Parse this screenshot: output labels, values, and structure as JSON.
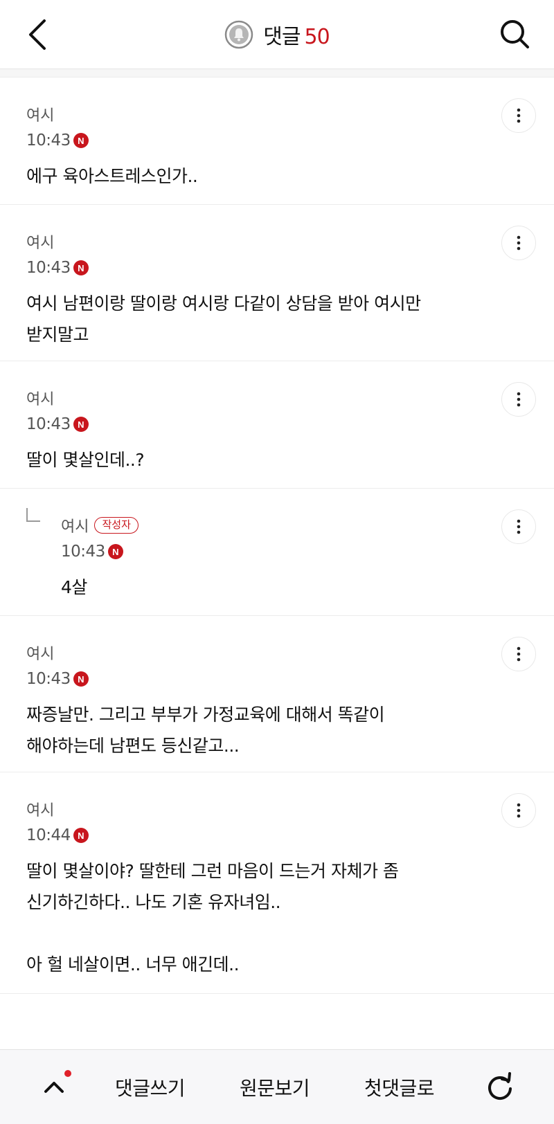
{
  "header": {
    "title": "댓글",
    "count": "50",
    "accent_color": "#c8161d"
  },
  "comments": [
    {
      "author": "여시",
      "time": "10:43",
      "new_badge": "N",
      "body": "에구 육아스트레스인가.."
    },
    {
      "author": "여시",
      "time": "10:43",
      "new_badge": "N",
      "body": "여시 남편이랑 딸이랑 여시랑 다같이 상담을 받아 여시만\n받지말고"
    },
    {
      "author": "여시",
      "time": "10:43",
      "new_badge": "N",
      "body": "딸이 몇살인데..?"
    },
    {
      "author": "여시",
      "author_badge": "작성자",
      "time": "10:43",
      "new_badge": "N",
      "body": "4살"
    },
    {
      "author": "여시",
      "time": "10:43",
      "new_badge": "N",
      "body": "짜증날만. 그리고 부부가 가정교육에 대해서 똑같이\n해야하는데 남편도 등신같고..."
    },
    {
      "author": "여시",
      "time": "10:44",
      "new_badge": "N",
      "body": "딸이 몇살이야? 딸한테 그런 마음이 드는거 자체가 좀\n신기하긴하다.. 나도 기혼 유자녀임..\n\n아 헐 네살이면.. 너무 애긴데.."
    }
  ],
  "bottom_bar": {
    "write": "댓글쓰기",
    "original": "원문보기",
    "first": "첫댓글로"
  },
  "icons": [
    "back-icon",
    "bell-icon",
    "search-icon",
    "more-vertical-icon",
    "reply-corner-icon",
    "chevron-up-icon",
    "refresh-icon"
  ]
}
